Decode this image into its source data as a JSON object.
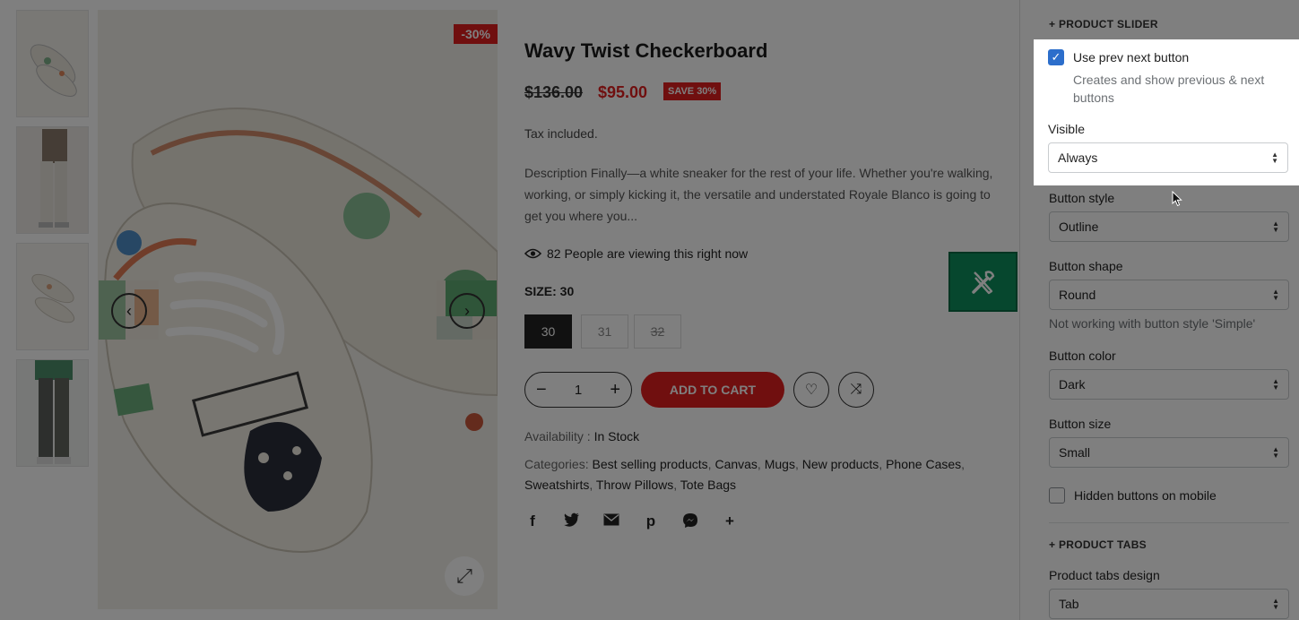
{
  "product": {
    "discount_badge": "-30%",
    "title": "Wavy Twist Checkerboard",
    "old_price": "$136.00",
    "new_price": "$95.00",
    "save_badge": "SAVE 30%",
    "tax": "Tax included.",
    "description": "Description Finally—a white sneaker for the rest of your life. Whether you're walking, working, or simply kicking it, the versatile and understated Royale Blanco is going to get you where you...",
    "viewing": "82 People are viewing this right now",
    "size_label": "SIZE: 30",
    "sizes": [
      "30",
      "31",
      "32"
    ],
    "quantity": "1",
    "qty_minus": "−",
    "qty_plus": "+",
    "add_to_cart": "ADD TO CART",
    "availability_label": "Availability :",
    "availability_value": "In Stock",
    "categories_label": "Categories:",
    "categories": [
      "Best selling products",
      "Canvas",
      "Mugs",
      "New products",
      "Phone Cases",
      "Sweatshirts",
      "Throw Pillows",
      "Tote Bags"
    ],
    "share_icons": [
      "facebook-icon",
      "twitter-icon",
      "email-icon",
      "pinterest-icon",
      "messenger-icon",
      "plus-icon"
    ]
  },
  "panel": {
    "slider_section": "+ PRODUCT SLIDER",
    "use_prev_next_label": "Use prev next button",
    "use_prev_next_checked": true,
    "use_prev_next_hint": "Creates and show previous & next buttons",
    "visible_label": "Visible",
    "visible_value": "Always",
    "button_style_label": "Button style",
    "button_style_value": "Outline",
    "button_shape_label": "Button shape",
    "button_shape_value": "Round",
    "button_shape_hint": "Not working with button style 'Simple'",
    "button_color_label": "Button color",
    "button_color_value": "Dark",
    "button_size_label": "Button size",
    "button_size_value": "Small",
    "hidden_mobile_label": "Hidden buttons on mobile",
    "hidden_mobile_checked": false,
    "tabs_section": "+ PRODUCT TABS",
    "tabs_design_label": "Product tabs design",
    "tabs_design_value": "Tab"
  },
  "colors": {
    "accent_red": "#e01f1f",
    "checkbox_blue": "#2c6ecb",
    "tools_green": "#0d8f5c"
  }
}
